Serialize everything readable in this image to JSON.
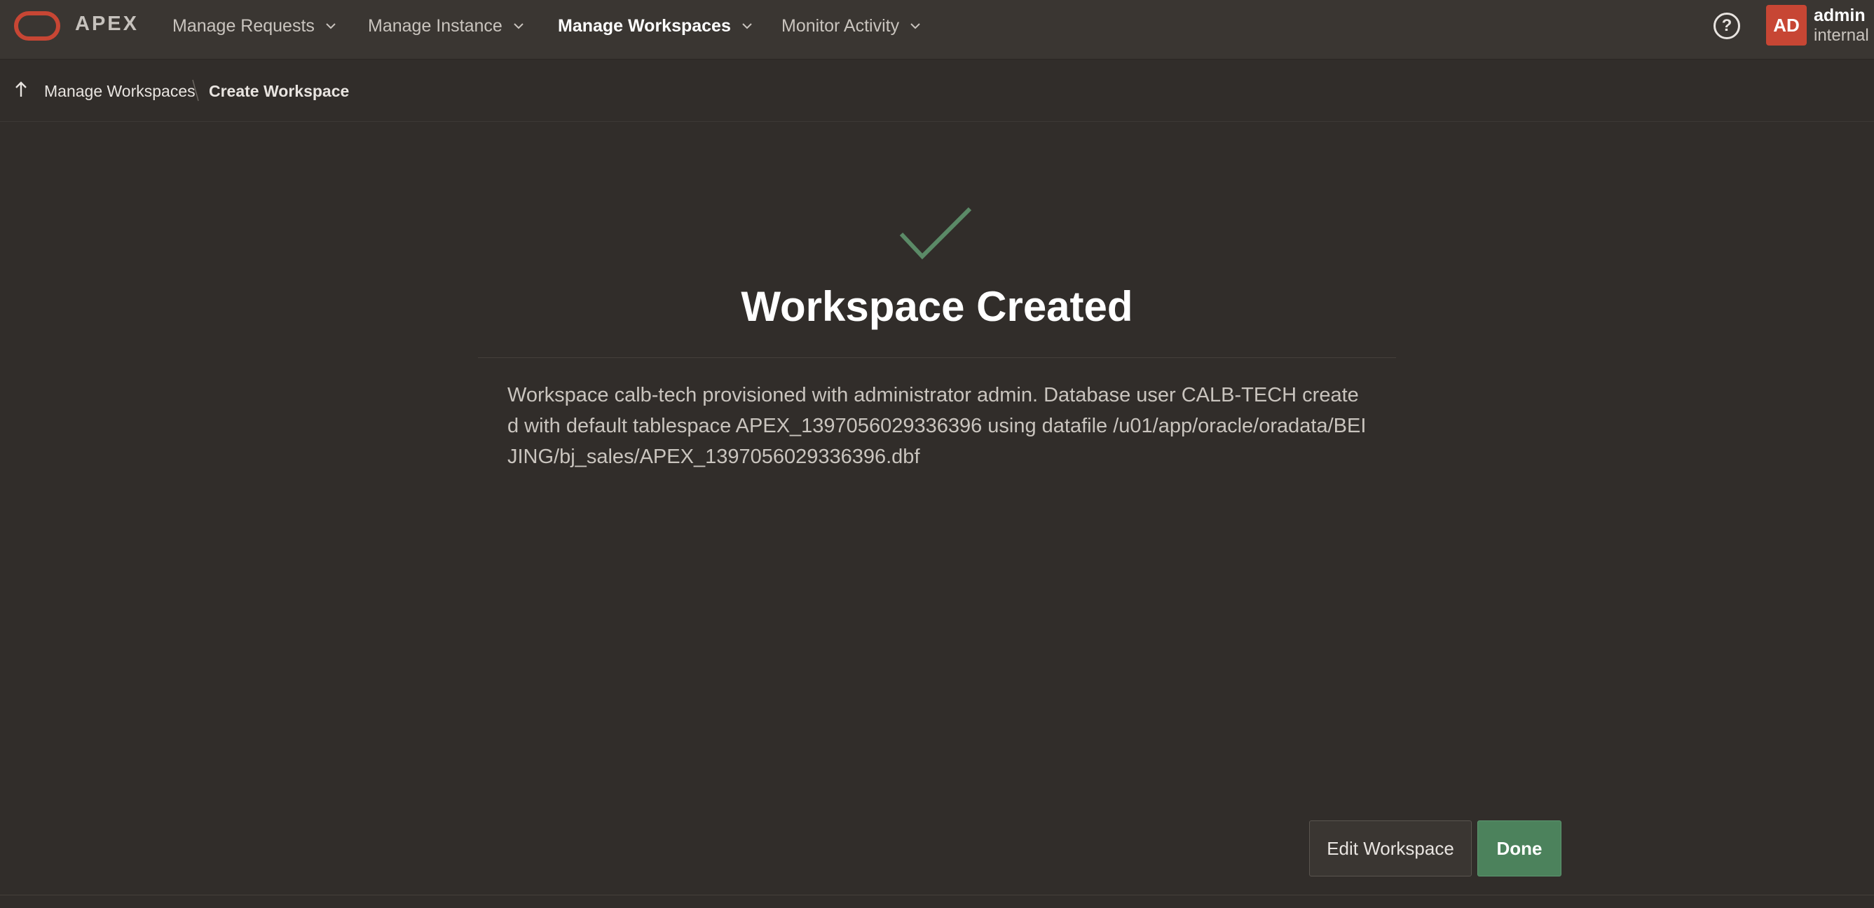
{
  "header": {
    "brand": "APEX",
    "nav": [
      {
        "label": "Manage Requests",
        "active": false
      },
      {
        "label": "Manage Instance",
        "active": false
      },
      {
        "label": "Manage Workspaces",
        "active": true
      },
      {
        "label": "Monitor Activity",
        "active": false
      }
    ],
    "help_symbol": "?",
    "user": {
      "initials": "AD",
      "name": "admin",
      "workspace": "internal"
    }
  },
  "breadcrumb": {
    "parent": "Manage Workspaces",
    "current": "Create Workspace"
  },
  "main": {
    "title": "Workspace Created",
    "message": "Workspace calb-tech provisioned with administrator admin. Database user CALB-TECH created with default tablespace APEX_1397056029336396 using datafile /u01/app/oracle/oradata/BEIJING/bj_sales/APEX_1397056029336396.dbf"
  },
  "buttons": {
    "edit_label": "Edit Workspace",
    "done_label": "Done"
  },
  "colors": {
    "accent_red": "#c74634",
    "success_green": "#4c825c",
    "background": "#312d2a"
  }
}
